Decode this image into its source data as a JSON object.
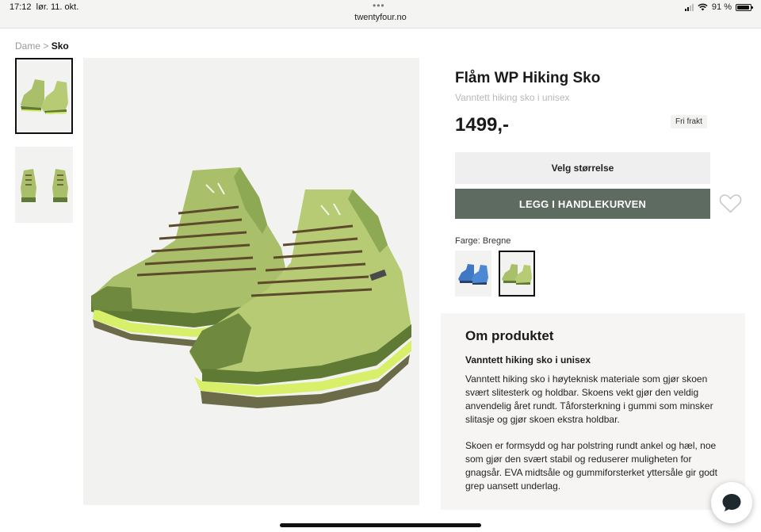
{
  "status_bar": {
    "time": "17:12",
    "date": "lør. 11. okt.",
    "url": "twentyfour.no",
    "battery_percent": "91 %",
    "battery_level": 0.91
  },
  "breadcrumb": {
    "parent": "Dame",
    "separator": ">",
    "current": "Sko"
  },
  "gallery": {
    "thumbnails": [
      "shoe-pair-side-view",
      "shoe-pair-front-view"
    ],
    "active_thumbnail": 0,
    "main_image": "shoe-pair-side-view"
  },
  "product": {
    "title": "Flåm WP Hiking Sko",
    "subtitle": "Vanntett hiking sko i unisex",
    "price": "1499,-",
    "badge": "Fri frakt",
    "size_button": "Velg størrelse",
    "cart_button": "LEGG I HANDLEKURVEN",
    "color_label": "Farge: Bregne",
    "swatches": [
      {
        "color": "blue",
        "selected": false
      },
      {
        "color": "green",
        "selected": true
      }
    ]
  },
  "about": {
    "heading": "Om produktet",
    "subheading": "Vanntett hiking sko i unisex",
    "paragraph1": "Vanntett hiking sko i høyteknisk materiale som gjør skoen svært slitesterk og holdbar. Skoens vekt gjør den veldig anvendelig året rundt. Tåforsterkning i gummi som minsker slitasje og gjør skoen ekstra holdbar.",
    "paragraph2": "Skoen er formsydd og har polstring rundt ankel og hæl, noe som gjør den svært stabil og reduserer muligheten for gnagsår. EVA midtsåle og gummiforsterket yttersåle gir godt grep uansett underlag."
  },
  "colors": {
    "cart_button": "#5d6b60",
    "shoe_upper": "#a9bf6a",
    "shoe_dark": "#5f7a35",
    "shoe_accent": "#d8ef6a",
    "swatch_blue": "#3f78c4"
  },
  "icons": {
    "wishlist": "heart-outline-icon",
    "chat": "chat-bubble-icon",
    "wifi": "wifi-icon",
    "signal": "signal-icon",
    "battery": "battery-icon"
  }
}
